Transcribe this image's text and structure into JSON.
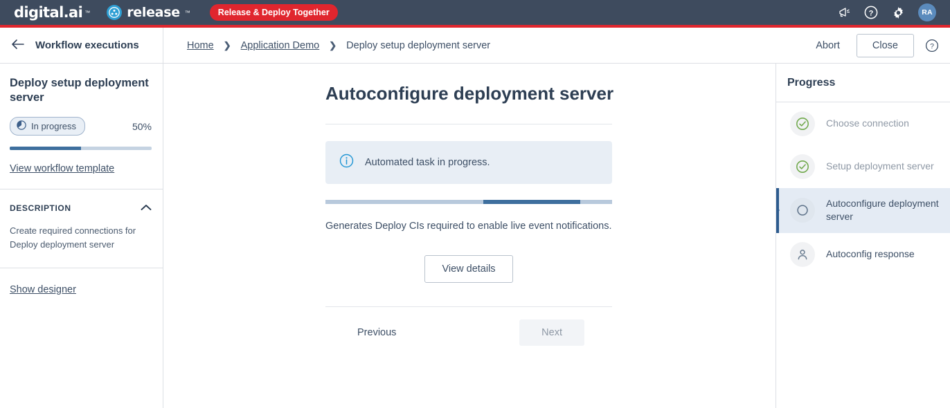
{
  "topnav": {
    "brand_primary": "digital.ai",
    "brand_product": "release",
    "promo_badge": "Release & Deploy Together",
    "icons": {
      "announcement": "megaphone-icon",
      "help": "help-circle-icon",
      "settings": "gear-icon"
    },
    "avatar_initials": "RA",
    "colors": {
      "bar": "#3e4b5e",
      "accent_strip": "#e0262e",
      "badge": "#e0262e",
      "avatar": "#5b8bbd"
    }
  },
  "subbar": {
    "back_icon": "arrow-left-icon",
    "section_title": "Workflow executions",
    "breadcrumb": [
      {
        "label": "Home",
        "link": true
      },
      {
        "label": "Application Demo",
        "link": true
      },
      {
        "label": "Deploy setup deployment server",
        "link": false
      }
    ],
    "breadcrumb_separator": "❯",
    "abort_label": "Abort",
    "close_label": "Close",
    "help_icon": "help-circle-icon"
  },
  "left_panel": {
    "heading": "Deploy setup deployment server",
    "status_badge": {
      "label": "In progress",
      "icon": "clock-pie-icon"
    },
    "percent_label": "50%",
    "percent_value": 50,
    "template_link": "View workflow template",
    "description": {
      "label": "DESCRIPTION",
      "collapse_icon": "chevron-up-icon",
      "text": "Create required connections for Deploy deployment server"
    },
    "designer_link": "Show designer"
  },
  "main": {
    "title": "Autoconfigure deployment server",
    "alert": {
      "icon": "info-circle-icon",
      "message": "Automated task in progress."
    },
    "indeterminate_bar": {
      "segment_start_pct": 55,
      "segment_width_pct": 34
    },
    "description": "Generates Deploy CIs required to enable live event notifications.",
    "view_details_label": "View details",
    "previous_label": "Previous",
    "next_label": "Next",
    "next_disabled": true
  },
  "progress_panel": {
    "title": "Progress",
    "steps": [
      {
        "label": "Choose connection",
        "state": "done",
        "icon": "check-circle-icon"
      },
      {
        "label": "Setup deployment server",
        "state": "done",
        "icon": "check-circle-icon"
      },
      {
        "label": "Autoconfigure deployment server",
        "state": "active",
        "icon": "circle-outline-icon"
      },
      {
        "label": "Autoconfig response",
        "state": "pending",
        "icon": "user-icon"
      }
    ],
    "colors": {
      "done": "#6fa84a",
      "active_bg": "#e4ebf4",
      "active_border": "#2d5b8e"
    }
  }
}
